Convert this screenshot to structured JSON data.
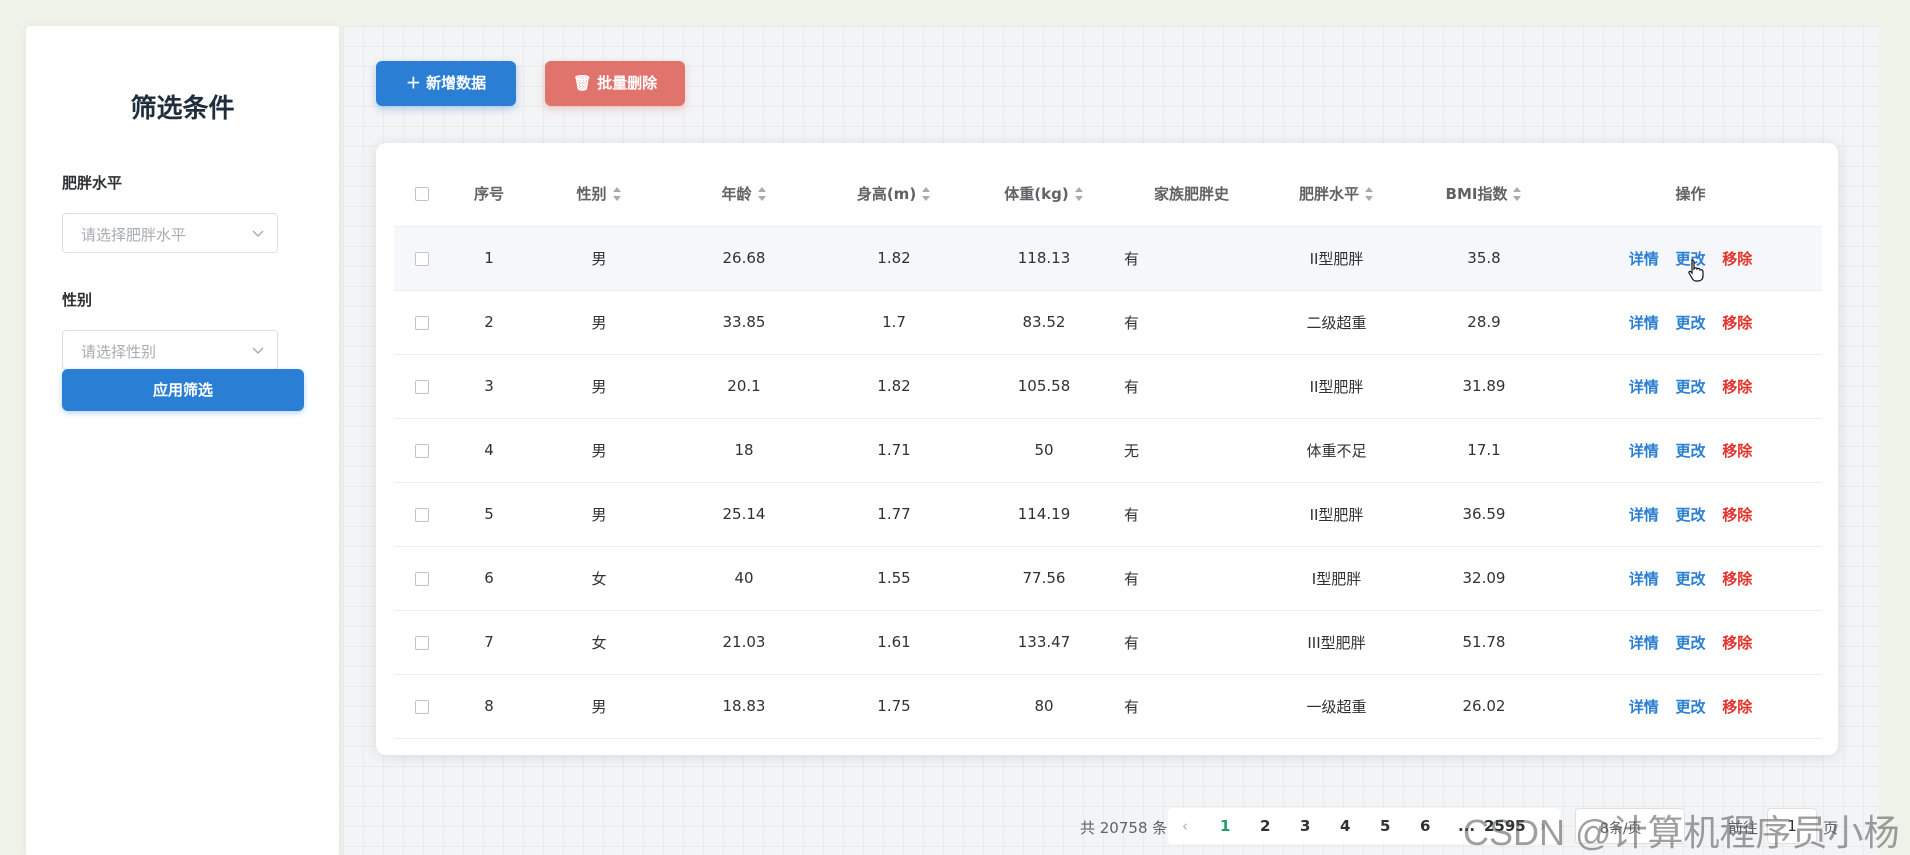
{
  "sidebar": {
    "title": "筛选条件",
    "filters": [
      {
        "label": "肥胖水平",
        "placeholder": "请选择肥胖水平"
      },
      {
        "label": "性别",
        "placeholder": "请选择性别"
      }
    ],
    "apply_label": "应用筛选"
  },
  "toolbar": {
    "add_label": "新增数据",
    "batch_delete_label": "批量删除"
  },
  "table": {
    "headers": [
      "序号",
      "性别",
      "年龄",
      "身高(m)",
      "体重(kg)",
      "家族肥胖史",
      "肥胖水平",
      "BMI指数",
      "操作"
    ],
    "rows": [
      [
        "1",
        "男",
        "26.68",
        "1.82",
        "118.13",
        "有",
        "II型肥胖",
        "35.8"
      ],
      [
        "2",
        "男",
        "33.85",
        "1.7",
        "83.52",
        "有",
        "二级超重",
        "28.9"
      ],
      [
        "3",
        "男",
        "20.1",
        "1.82",
        "105.58",
        "有",
        "II型肥胖",
        "31.89"
      ],
      [
        "4",
        "男",
        "18",
        "1.71",
        "50",
        "无",
        "体重不足",
        "17.1"
      ],
      [
        "5",
        "男",
        "25.14",
        "1.77",
        "114.19",
        "有",
        "II型肥胖",
        "36.59"
      ],
      [
        "6",
        "女",
        "40",
        "1.55",
        "77.56",
        "有",
        "I型肥胖",
        "32.09"
      ],
      [
        "7",
        "女",
        "21.03",
        "1.61",
        "133.47",
        "有",
        "III型肥胖",
        "51.78"
      ],
      [
        "8",
        "男",
        "18.83",
        "1.75",
        "80",
        "有",
        "一级超重",
        "26.02"
      ]
    ],
    "actions": {
      "detail": "详情",
      "edit": "更改",
      "remove": "移除"
    }
  },
  "pagination": {
    "total_text": "共 20758 条",
    "pages": [
      "1",
      "2",
      "3",
      "4",
      "5",
      "6"
    ],
    "ellipsis": "...",
    "last_page": "2595",
    "current_page": "1",
    "page_size": "8条/页",
    "goto_label": "前往",
    "goto_value": "1",
    "page_unit": "页"
  },
  "watermark": "CSDN @计算机程序员小杨",
  "colors": {
    "primary": "#2a7fd4",
    "danger_button": "#e0736b",
    "remove_link": "#e0352b",
    "active_page": "#22a06b"
  }
}
